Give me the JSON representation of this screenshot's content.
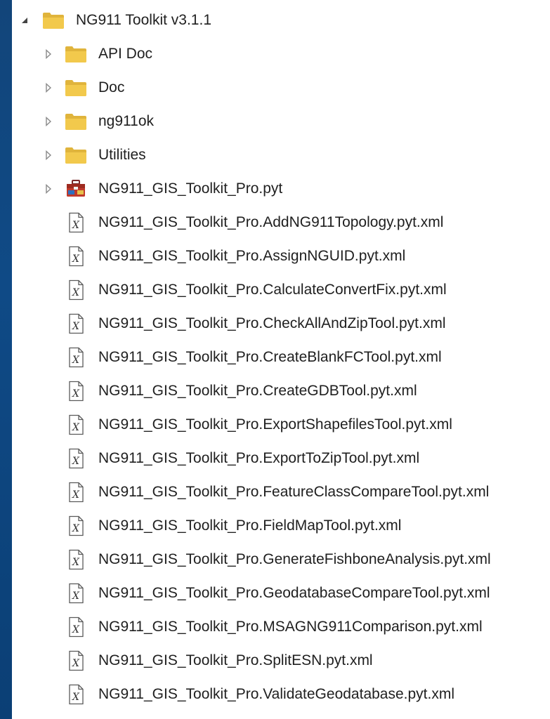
{
  "tree": {
    "root": {
      "label": "NG911 Toolkit v3.1.1",
      "icon": "folder-icon",
      "expanded": true
    },
    "folders": [
      {
        "label": "API Doc",
        "icon": "folder-icon"
      },
      {
        "label": "Doc",
        "icon": "folder-icon"
      },
      {
        "label": "ng911ok",
        "icon": "folder-icon"
      },
      {
        "label": "Utilities",
        "icon": "folder-icon"
      }
    ],
    "toolbox": {
      "label": "NG911_GIS_Toolkit_Pro.pyt",
      "icon": "python-toolbox-icon"
    },
    "files": [
      {
        "label": "NG911_GIS_Toolkit_Pro.AddNG911Topology.pyt.xml"
      },
      {
        "label": "NG911_GIS_Toolkit_Pro.AssignNGUID.pyt.xml"
      },
      {
        "label": "NG911_GIS_Toolkit_Pro.CalculateConvertFix.pyt.xml"
      },
      {
        "label": "NG911_GIS_Toolkit_Pro.CheckAllAndZipTool.pyt.xml"
      },
      {
        "label": "NG911_GIS_Toolkit_Pro.CreateBlankFCTool.pyt.xml"
      },
      {
        "label": "NG911_GIS_Toolkit_Pro.CreateGDBTool.pyt.xml"
      },
      {
        "label": "NG911_GIS_Toolkit_Pro.ExportShapefilesTool.pyt.xml"
      },
      {
        "label": "NG911_GIS_Toolkit_Pro.ExportToZipTool.pyt.xml"
      },
      {
        "label": "NG911_GIS_Toolkit_Pro.FeatureClassCompareTool.pyt.xml"
      },
      {
        "label": "NG911_GIS_Toolkit_Pro.FieldMapTool.pyt.xml"
      },
      {
        "label": "NG911_GIS_Toolkit_Pro.GenerateFishboneAnalysis.pyt.xml"
      },
      {
        "label": "NG911_GIS_Toolkit_Pro.GeodatabaseCompareTool.pyt.xml"
      },
      {
        "label": "NG911_GIS_Toolkit_Pro.MSAGNG911Comparison.pyt.xml"
      },
      {
        "label": "NG911_GIS_Toolkit_Pro.SplitESN.pyt.xml"
      },
      {
        "label": "NG911_GIS_Toolkit_Pro.ValidateGeodatabase.pyt.xml"
      }
    ]
  },
  "colors": {
    "folder": "#f2c94c",
    "folder_dark": "#e0b43c",
    "text": "#1f1f1f",
    "toggle": "#8a8a8a",
    "background": "#0f4a86"
  }
}
